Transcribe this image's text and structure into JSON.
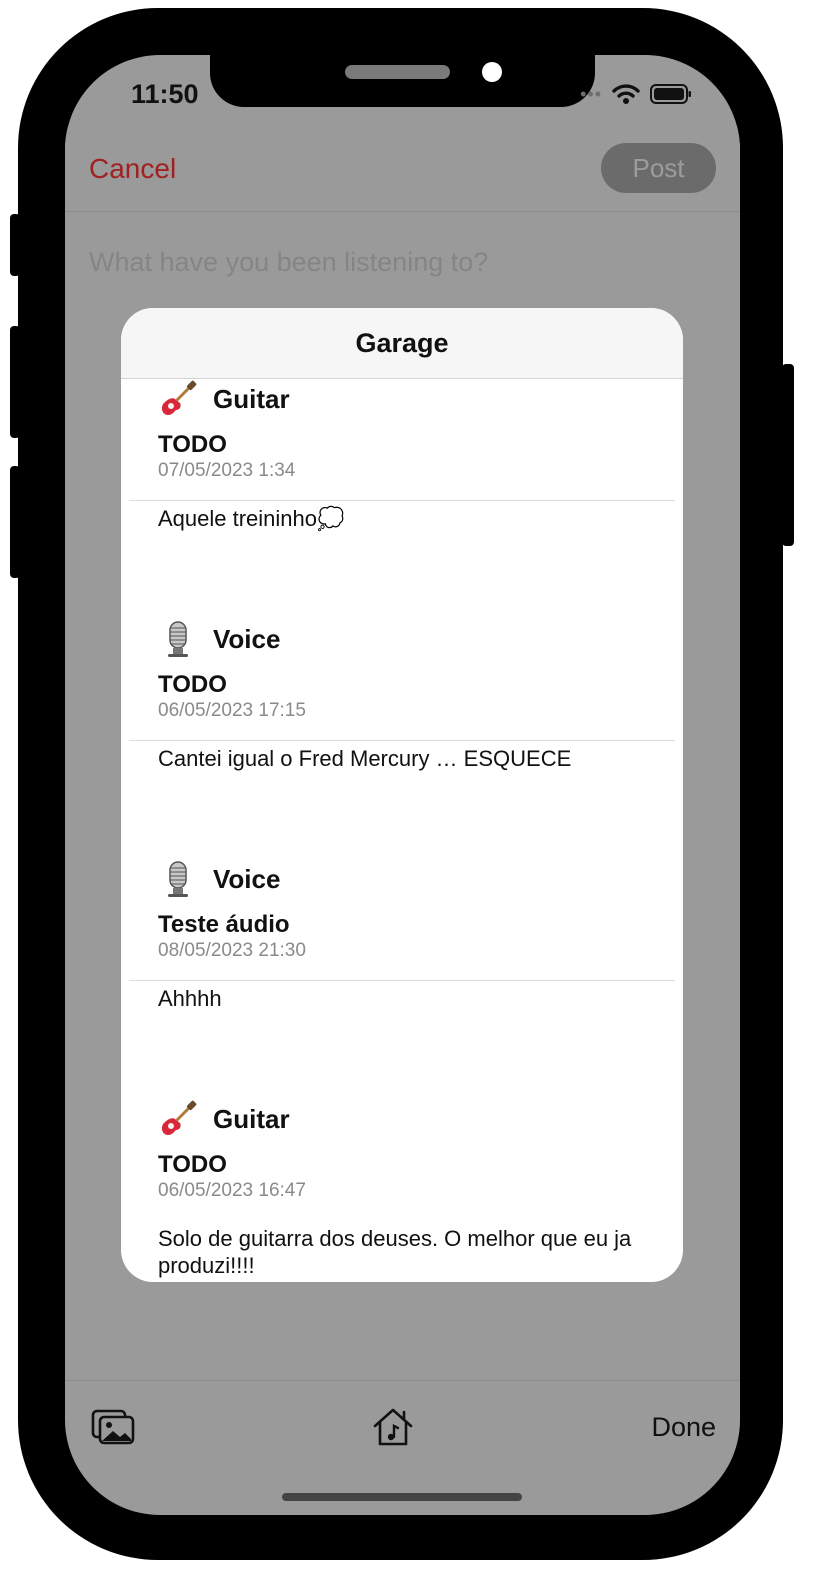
{
  "status_bar": {
    "time": "11:50",
    "dots": "•••",
    "wifi_icon": "wifi-icon",
    "battery_icon": "battery-icon"
  },
  "nav": {
    "cancel_label": "Cancel",
    "post_label": "Post",
    "cancel_color": "#a12020"
  },
  "compose": {
    "placeholder": "What have you been listening to?"
  },
  "modal": {
    "title": "Garage",
    "entries": [
      {
        "instrument": "Guitar",
        "icon": "guitar-icon",
        "title": "TODO",
        "date": "07/05/2023 1:34",
        "text": "Aquele treininho💭"
      },
      {
        "instrument": "Voice",
        "icon": "microphone-icon",
        "title": "TODO",
        "date": "06/05/2023 17:15",
        "text": "Cantei igual o Fred Mercury … ESQUECE"
      },
      {
        "instrument": "Voice",
        "icon": "microphone-icon",
        "title": "Teste áudio",
        "date": "08/05/2023 21:30",
        "text": "Ahhhh"
      },
      {
        "instrument": "Guitar",
        "icon": "guitar-icon",
        "title": "TODO",
        "date": "06/05/2023 16:47",
        "text": "Solo de guitarra dos deuses. O melhor que eu ja produzi!!!!"
      }
    ]
  },
  "toolbar": {
    "photos_icon": "photo-library-icon",
    "garage_icon": "music-house-icon",
    "done_label": "Done"
  }
}
